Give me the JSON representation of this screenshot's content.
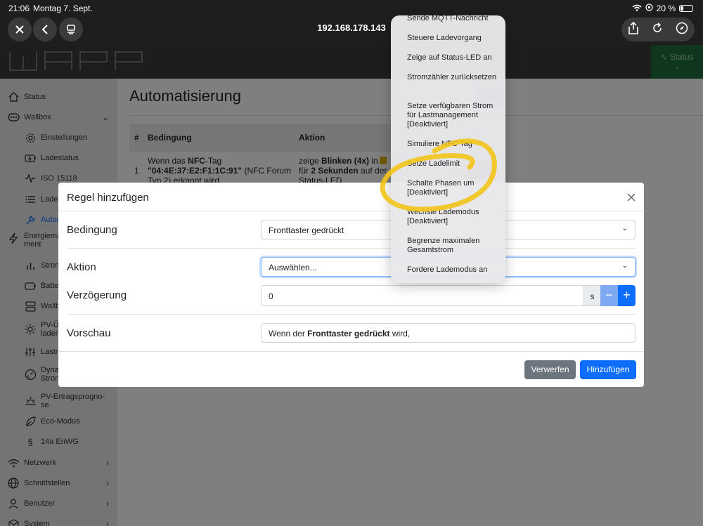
{
  "ios_status": {
    "time": "21:06",
    "date": "Montag 7. Sept.",
    "battery": "20 %"
  },
  "browser": {
    "url": "192.168.178.143"
  },
  "header": {
    "status_label": "Status"
  },
  "sidebar": {
    "items": [
      {
        "label": "Status",
        "icon": "home-icon"
      },
      {
        "label": "Wallbox",
        "icon": "wallbox-icon"
      },
      {
        "label": "Einstellungen",
        "icon": "gear-icon"
      },
      {
        "label": "Ladestatus",
        "icon": "battery-charge-icon"
      },
      {
        "label": "ISO 15118",
        "icon": "activity-icon"
      },
      {
        "label": "Lade",
        "icon": "list-icon"
      },
      {
        "label": "Autor",
        "icon": "tool-icon"
      },
      {
        "label": "Energiema ment",
        "icon": "bolt-icon"
      },
      {
        "label": "Stron",
        "icon": "bar-chart-icon"
      },
      {
        "label": "Batte",
        "icon": "battery-icon"
      },
      {
        "label": "Wallb",
        "icon": "server-icon"
      },
      {
        "label": "PV-Ü lader",
        "icon": "sun-icon"
      },
      {
        "label": "Lastn",
        "icon": "sliders-icon"
      },
      {
        "label": "Dyna Stron",
        "icon": "gauge-icon"
      },
      {
        "label": "PV-Ertragsprogno-se",
        "icon": "sunrise-icon"
      },
      {
        "label": "Eco-Modus",
        "icon": "leaf-icon"
      },
      {
        "label": "14a EnWG",
        "icon": "paragraph-icon"
      },
      {
        "label": "Netzwerk",
        "icon": "wifi-icon"
      },
      {
        "label": "Schnittstellen",
        "icon": "globe-icon"
      },
      {
        "label": "Benutzer",
        "icon": "user-icon"
      },
      {
        "label": "System",
        "icon": "box-icon"
      }
    ]
  },
  "main": {
    "title": "Automatisierung",
    "table": {
      "headers": [
        "#",
        "Bedingung",
        "Aktion"
      ],
      "row": {
        "num": "1",
        "cond_pre": "Wenn das ",
        "cond_bold1": "NFC",
        "cond_mid": "-Tag",
        "cond_tag": "\"04:4E:37:E2:F1:1C:91\"",
        "cond_post": " (NFC Forum",
        "cond_line3": "Typ 2) erkannt wird",
        "act_pre": "zeige ",
        "act_bold1": "Blinken (4x)",
        "act_mid": " in",
        "act_line2_pre": "für ",
        "act_bold2": "2 Sekunden",
        "act_line2_post": " auf der",
        "act_line3": "Status-LED"
      }
    }
  },
  "modal": {
    "title": "Regel hinzufügen",
    "fields": {
      "bedingung_label": "Bedingung",
      "bedingung_value": "Fronttaster gedrückt",
      "aktion_label": "Aktion",
      "aktion_value": "Auswählen...",
      "verzoegerung_label": "Verzögerung",
      "verzoegerung_value": "0",
      "verzoegerung_unit": "s",
      "vorschau_label": "Vorschau",
      "vorschau_pre": "Wenn der ",
      "vorschau_bold": "Fronttaster gedrückt",
      "vorschau_post": " wird,"
    },
    "buttons": {
      "discard": "Verwerfen",
      "add": "Hinzufügen"
    }
  },
  "popup_menu": {
    "items": [
      "Sende MQTT-Nachricht",
      "Steuere Ladevorgang",
      "Zeige auf Status-LED an",
      "Stromzähler zurücksetzen",
      "Setze verfügbaren Strom für Lastmanagement [Deaktiviert]",
      "Simuliere NFC-Tag",
      "Setze Ladelimit",
      "Schalte Phasen um [Deaktiviert]",
      "Wechsle Lademodus [Deaktiviert]",
      "Begrenze maximalen Gesamtstrom",
      "Fordere Lademodus an"
    ]
  },
  "colors": {
    "primary": "#0d6efd",
    "secondary": "#6c757d",
    "annotation": "#f2c418",
    "status_green": "#1f6e3a"
  }
}
